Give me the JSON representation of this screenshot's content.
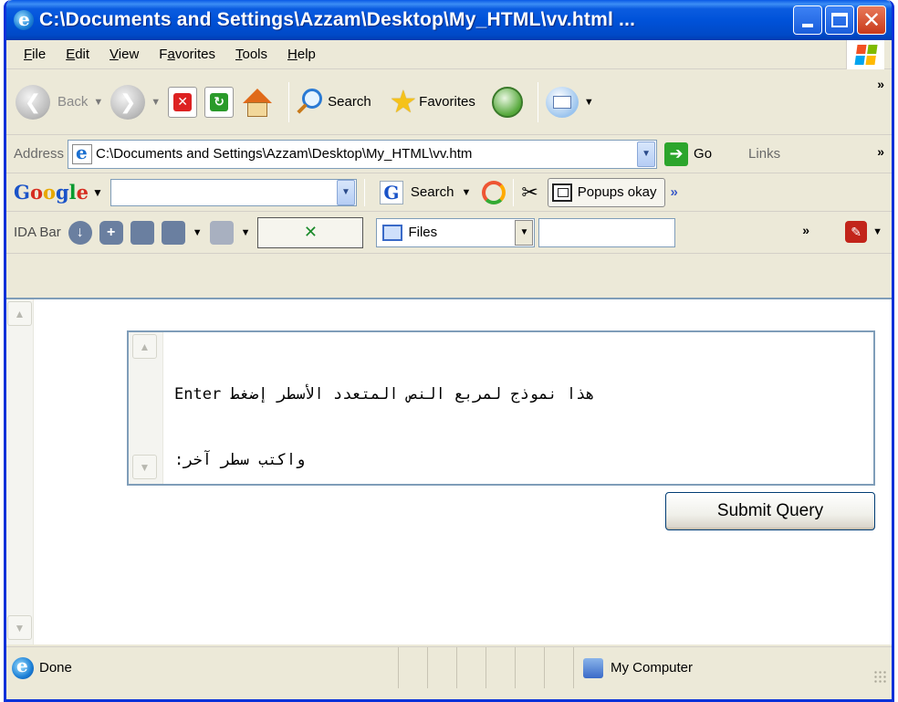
{
  "window": {
    "title": "C:\\Documents and Settings\\Azzam\\Desktop\\My_HTML\\vv.html ..."
  },
  "menu": {
    "items": [
      {
        "label": "File",
        "underline": "F",
        "rest": "ile"
      },
      {
        "label": "Edit",
        "underline": "E",
        "rest": "dit"
      },
      {
        "label": "View",
        "underline": "V",
        "rest": "iew"
      },
      {
        "label": "Favorites",
        "pre": "F",
        "underline": "a",
        "rest": "vorites"
      },
      {
        "label": "Tools",
        "underline": "T",
        "rest": "ools"
      },
      {
        "label": "Help",
        "underline": "H",
        "rest": "elp"
      }
    ]
  },
  "toolbar": {
    "back_label": "Back",
    "search_label": "Search",
    "favorites_label": "Favorites",
    "overflow": "»"
  },
  "address": {
    "label": "Address",
    "value": "C:\\Documents and Settings\\Azzam\\Desktop\\My_HTML\\vv.htm",
    "go_label": "Go",
    "links_label": "Links",
    "overflow": "»"
  },
  "google": {
    "logo": [
      "G",
      "o",
      "o",
      "g",
      "l",
      "e"
    ],
    "search_label": "Search",
    "popups_label": "Popups okay",
    "overflow": "»"
  },
  "ida": {
    "label": "IDA Bar",
    "files_value": "Files",
    "overflow": "»"
  },
  "content": {
    "textarea_line1": "هذا نموذج لمربع النص المتعدد الأسطر إضغط Enter",
    "textarea_line2": "واكتب سطر آخر:",
    "submit_label": "Submit Query"
  },
  "status": {
    "text": "Done",
    "zone": "My Computer"
  },
  "colors": {
    "titlebar": "#0052d9",
    "chrome": "#ece9d8",
    "border_blue": "#7f9db9"
  }
}
